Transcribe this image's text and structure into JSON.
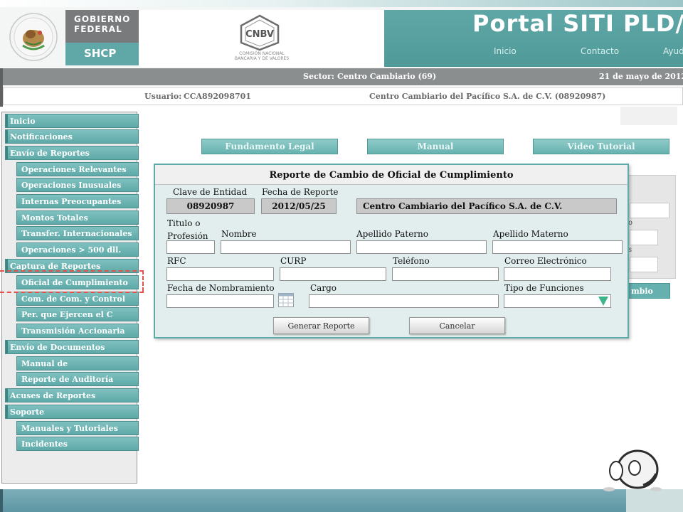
{
  "header": {
    "gov_line1": "GOBIERNO",
    "gov_line2": "FEDERAL",
    "shcp": "SHCP",
    "cnbv_logo": "CNBV",
    "cnbv_name_line1": "COMISIÓN NACIONAL",
    "cnbv_name_line2": "BANCARIA Y DE VALORES",
    "portal_title": "Portal SITI PLD/FT",
    "nav": [
      "Inicio",
      "Contacto",
      "Ayud"
    ]
  },
  "info": {
    "sector_label": "Sector:",
    "sector_value": "Centro  Cambiario (69)",
    "date": "21 de mayo de 2012",
    "user_label": "Usuario:",
    "user_value": "CCA892098701",
    "entity": "Centro Cambiario del Pacífico S.A. de C.V. (08920987)"
  },
  "sidebar": {
    "items": [
      {
        "label": "Inicio",
        "level": "main"
      },
      {
        "label": "Notificaciones",
        "level": "main"
      },
      {
        "label": "Envío de Reportes",
        "level": "main"
      },
      {
        "label": "Operaciones Relevantes",
        "level": "sub"
      },
      {
        "label": "Operaciones Inusuales",
        "level": "sub"
      },
      {
        "label": "Internas Preocupantes",
        "level": "sub"
      },
      {
        "label": "Montos Totales",
        "level": "sub"
      },
      {
        "label": "Transfer. Internacionales",
        "level": "sub"
      },
      {
        "label": "Operaciones > 500 dll.",
        "level": "sub"
      },
      {
        "label": "Captura de Reportes",
        "level": "main"
      },
      {
        "label": "Oficial de Cumplimiento",
        "level": "sub"
      },
      {
        "label": "Com. de Com. y Control",
        "level": "sub"
      },
      {
        "label": "Per. que Ejercen el C",
        "level": "sub"
      },
      {
        "label": "Transmisión Accionaria",
        "level": "sub"
      },
      {
        "label": "Envío de Documentos",
        "level": "main"
      },
      {
        "label": "Manual de",
        "level": "sub"
      },
      {
        "label": "Reporte de Auditoría",
        "level": "sub"
      },
      {
        "label": "Acuses de Reportes",
        "level": "main"
      },
      {
        "label": "Soporte",
        "level": "main"
      },
      {
        "label": "Manuales y Tutoriales",
        "level": "sub"
      },
      {
        "label": "Incidentes",
        "level": "sub"
      }
    ]
  },
  "page": {
    "buttons": [
      "Fundamento Legal",
      "Manual",
      "Video Tutorial"
    ],
    "hidden_button_fragment": "mbio",
    "hidden_labels": [
      "o",
      "s"
    ]
  },
  "modal": {
    "title": "Reporte de Cambio de Oficial de Cumplimiento",
    "clave_label": "Clave de Entidad",
    "clave_value": "08920987",
    "fecha_label": "Fecha de Reporte",
    "fecha_value": "2012/05/25",
    "entity_value": "Centro Cambiario del Pacífico S.A. de C.V.",
    "titulo_label_1": "Titulo o",
    "titulo_label_2": "Profesión",
    "nombre_label": "Nombre",
    "ap_paterno_label": "Apellido Paterno",
    "ap_materno_label": "Apellido Materno",
    "rfc_label": "RFC",
    "curp_label": "CURP",
    "telefono_label": "Teléfono",
    "correo_label": "Correo Electrónico",
    "fecha_nombramiento_label": "Fecha de Nombramiento",
    "cargo_label": "Cargo",
    "tipo_funciones_label": "Tipo de Funciones",
    "generar_label": "Generar Reporte",
    "cancelar_label": "Cancelar"
  },
  "colors": {
    "teal": "#5ea9a8",
    "sector_bar": "#8b8e8f",
    "dashed_highlight": "#e0524a",
    "select_arrow": "#3fb48a"
  },
  "icons": [
    "mexico-seal-icon",
    "cnbv-logo-icon",
    "calendar-icon",
    "select-arrow-icon",
    "mascot-icon"
  ]
}
